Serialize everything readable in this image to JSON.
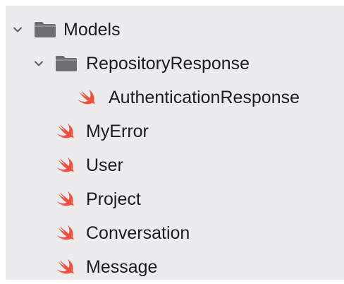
{
  "colors": {
    "panel_bg": "#ecebee",
    "folder_icon": "#6e6e73",
    "swift_icon": "#f05138",
    "text": "#1d1d1f"
  },
  "tree": {
    "root": {
      "label": "Models",
      "icon": "folder-icon",
      "expanded": true
    },
    "group": {
      "label": "RepositoryResponse",
      "icon": "folder-icon",
      "expanded": true
    },
    "group_children": [
      {
        "label": "AuthenticationResponse",
        "icon": "swift-file-icon"
      }
    ],
    "root_children": [
      {
        "label": "MyError",
        "icon": "swift-file-icon"
      },
      {
        "label": "User",
        "icon": "swift-file-icon"
      },
      {
        "label": "Project",
        "icon": "swift-file-icon"
      },
      {
        "label": "Conversation",
        "icon": "swift-file-icon"
      },
      {
        "label": "Message",
        "icon": "swift-file-icon"
      }
    ]
  }
}
